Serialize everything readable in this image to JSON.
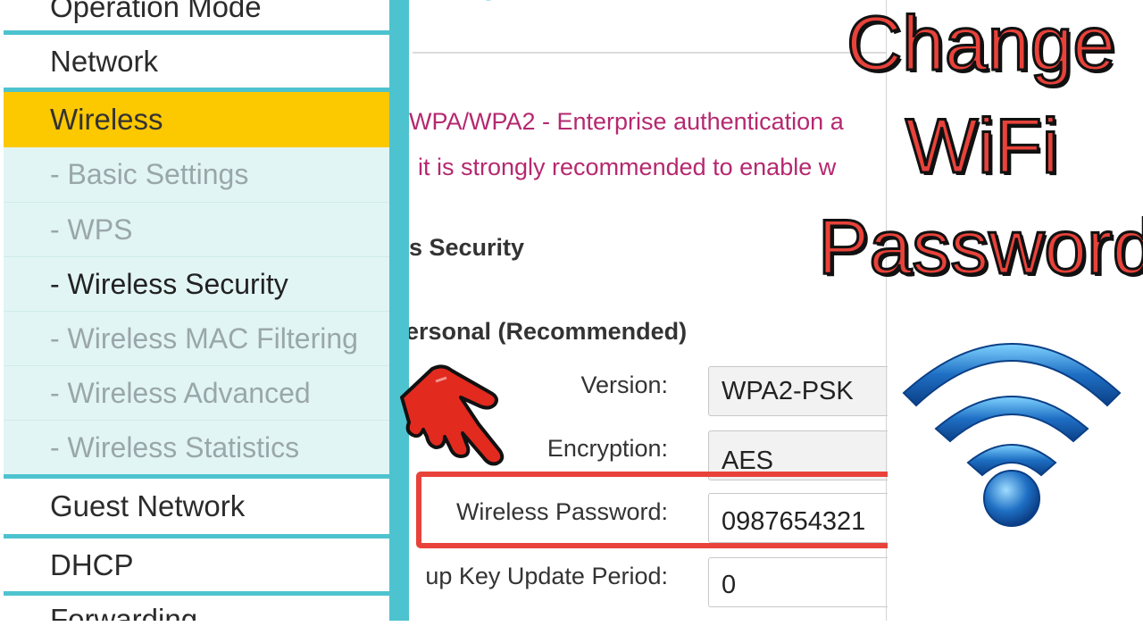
{
  "sidebar": {
    "items": [
      {
        "label": "Operation Mode",
        "type": "main"
      },
      {
        "label": "Network",
        "type": "main"
      },
      {
        "label": "Wireless",
        "type": "active"
      },
      {
        "label": "- Basic Settings",
        "type": "sub"
      },
      {
        "label": "- WPS",
        "type": "sub"
      },
      {
        "label": "- Wireless Security",
        "type": "sub-current"
      },
      {
        "label": "- Wireless MAC Filtering",
        "type": "sub"
      },
      {
        "label": "- Wireless Advanced",
        "type": "sub"
      },
      {
        "label": "- Wireless Statistics",
        "type": "sub"
      },
      {
        "label": "Guest Network",
        "type": "main"
      },
      {
        "label": "DHCP",
        "type": "main"
      },
      {
        "label": "Forwarding",
        "type": "main"
      }
    ]
  },
  "content": {
    "notice_line1": "WPA/WPA2 - Enterprise authentication a",
    "notice_line2": "it is strongly recommended to enable w",
    "section_title": "s Security",
    "subsection_title": "ersonal (Recommended)",
    "fields": {
      "version": {
        "label": "Version:",
        "value": "WPA2-PSK"
      },
      "encryption": {
        "label": "Encryption:",
        "value": "AES"
      },
      "password": {
        "label": "Wireless Password:",
        "value": "0987654321"
      },
      "group_key": {
        "label": "up Key Update Period:",
        "value": "0"
      }
    }
  },
  "overlay": {
    "line1": "Change",
    "line2": "WiFi",
    "line3": "Password"
  },
  "colors": {
    "accent_teal": "#4dc3cf",
    "active_yellow": "#fcc800",
    "notice_magenta": "#b5286f",
    "highlight_red": "#e8423a",
    "wifi_blue": "#1e6fc4"
  },
  "icons": {
    "pointer": "pointing-hand-icon",
    "wifi": "wifi-icon"
  }
}
